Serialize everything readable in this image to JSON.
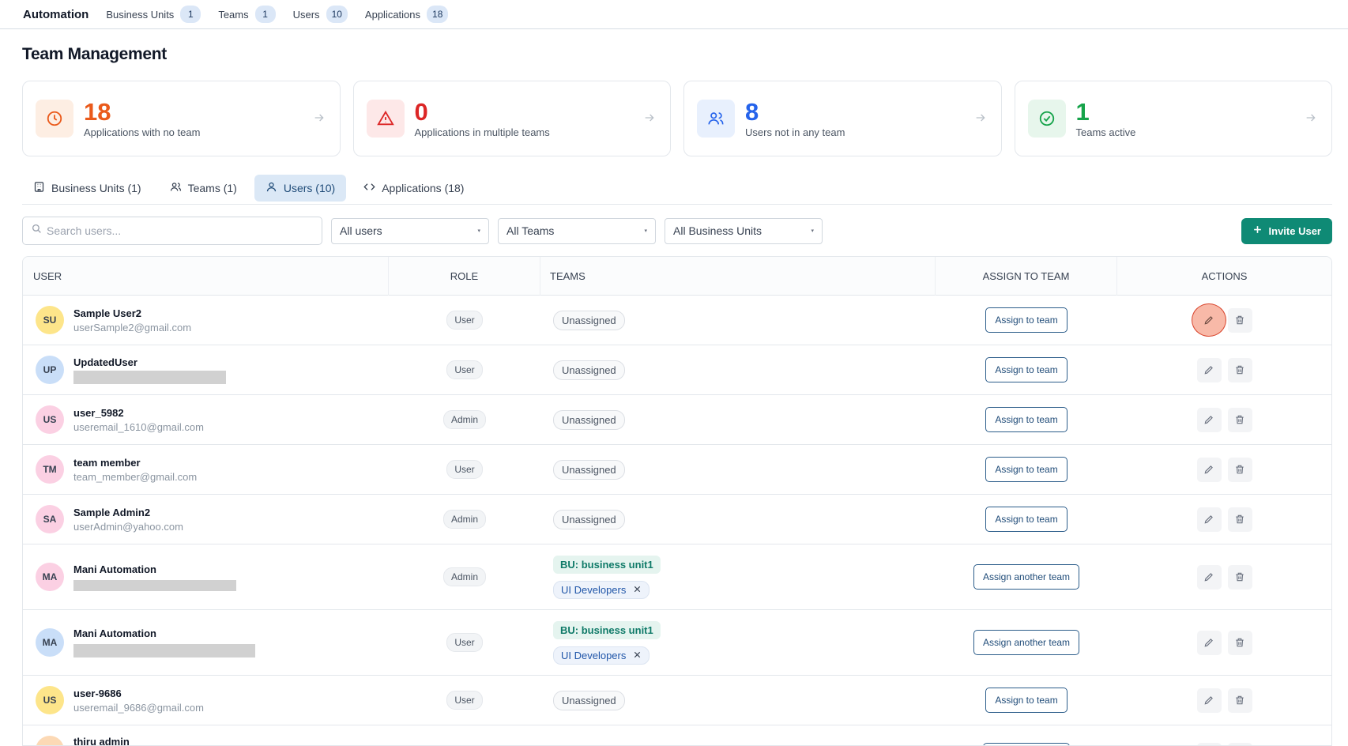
{
  "app": {
    "brand": "Automation"
  },
  "topnav": [
    {
      "label": "Business Units",
      "count": "1"
    },
    {
      "label": "Teams",
      "count": "1"
    },
    {
      "label": "Users",
      "count": "10"
    },
    {
      "label": "Applications",
      "count": "18"
    }
  ],
  "page": {
    "title": "Team Management"
  },
  "stats": [
    {
      "value": "18",
      "label": "Applications with no team",
      "color": "#ea5a1b",
      "icon": "clock-icon"
    },
    {
      "value": "0",
      "label": "Applications in multiple teams",
      "color": "#dc2626",
      "icon": "warning-icon"
    },
    {
      "value": "8",
      "label": "Users not in any team",
      "color": "#2563eb",
      "icon": "users-icon"
    },
    {
      "value": "1",
      "label": "Teams active",
      "color": "#16a34a",
      "icon": "check-circle-icon"
    }
  ],
  "tabs": [
    {
      "label": "Business Units (1)",
      "icon": "building-icon"
    },
    {
      "label": "Teams (1)",
      "icon": "users-icon"
    },
    {
      "label": "Users (10)",
      "icon": "user-icon"
    },
    {
      "label": "Applications (18)",
      "icon": "code-icon"
    }
  ],
  "filters": {
    "search_placeholder": "Search users...",
    "role_select": "All users",
    "team_select": "All Teams",
    "bu_select": "All Business Units",
    "invite_label": "Invite User"
  },
  "table": {
    "headers": {
      "user": "USER",
      "role": "ROLE",
      "teams": "TEAMS",
      "assign": "ASSIGN TO TEAM",
      "actions": "ACTIONS"
    },
    "rows": [
      {
        "initials": "SU",
        "name": "Sample User2",
        "email": "userSample2@gmail.com",
        "role": "User",
        "team": "Unassigned",
        "assign": "Assign to team",
        "avatar_color": "#fde58a"
      },
      {
        "initials": "UP",
        "name": "UpdatedUser",
        "email": "",
        "role": "User",
        "team": "Unassigned",
        "assign": "Assign to team",
        "avatar_color": "#c9def8"
      },
      {
        "initials": "US",
        "name": "user_5982",
        "email": "useremail_1610@gmail.com",
        "role": "Admin",
        "team": "Unassigned",
        "assign": "Assign to team",
        "avatar_color": "#fbd0e3"
      },
      {
        "initials": "TM",
        "name": "team member",
        "email": "team_member@gmail.com",
        "role": "User",
        "team": "Unassigned",
        "assign": "Assign to team",
        "avatar_color": "#fbd0e3"
      },
      {
        "initials": "SA",
        "name": "Sample Admin2",
        "email": "userAdmin@yahoo.com",
        "role": "Admin",
        "team": "Unassigned",
        "assign": "Assign to team",
        "avatar_color": "#fbd0e3"
      },
      {
        "initials": "MA",
        "name": "Mani Automation",
        "email": "",
        "role": "Admin",
        "bu": "BU: business unit1",
        "team_tag": "UI Developers",
        "assign": "Assign another team",
        "avatar_color": "#fbd0e3"
      },
      {
        "initials": "MA",
        "name": "Mani Automation",
        "email": "",
        "role": "User",
        "bu": "BU: business unit1",
        "team_tag": "UI Developers",
        "assign": "Assign another team",
        "avatar_color": "#c9def8"
      },
      {
        "initials": "US",
        "name": "user-9686",
        "email": "useremail_9686@gmail.com",
        "role": "User",
        "team": "Unassigned",
        "assign": "Assign to team",
        "avatar_color": "#fde58a"
      },
      {
        "initials": "",
        "name": "thiru admin",
        "email": "",
        "role": "",
        "team": "",
        "assign": "",
        "avatar_color": "#fcd9b5"
      }
    ]
  }
}
